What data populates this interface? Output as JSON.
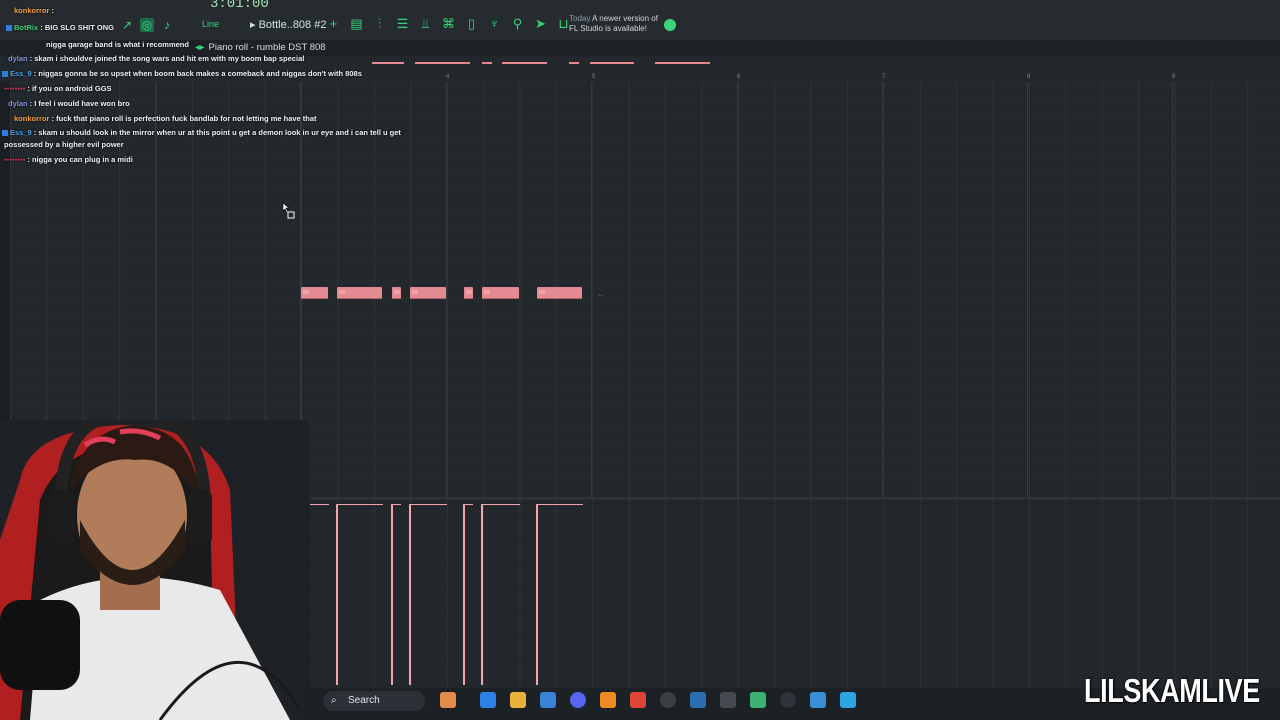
{
  "toolbar": {
    "time": "3:01:00",
    "line_mode": "Line",
    "pattern": "Bottle..808 #2",
    "update_today": "Today",
    "update_msg_1": "A newer version of",
    "update_msg_2": "FL Studio is available!"
  },
  "piano_roll": {
    "title": "Piano roll - rumble DST 808",
    "bar_numbers": [
      "4",
      "5",
      "6",
      "7",
      "8",
      "9"
    ]
  },
  "chat": [
    {
      "user": "konkorror",
      "text": "",
      "user_color": "#f2a33a"
    },
    {
      "user": "BotRix",
      "text": "BIG SLG SHIT ONG",
      "user_color": "#3bd37c"
    },
    {
      "user": "",
      "text": "nigga garage band is what i recommend",
      "user_color": "#c0394a"
    },
    {
      "user": "dylan",
      "text": "skam i shouldve joined the song wars and hit em with my boom bap special",
      "user_color": "#7f92d8"
    },
    {
      "user": "Ess_9",
      "text": "niggas gonna be so upset when boom back makes a comeback and niggas don't with 808s",
      "user_color": "#4ba0e0"
    },
    {
      "user": "",
      "text": "if you on android GGS",
      "user_color": "#c0394a"
    },
    {
      "user": "dylan",
      "text": "I feel i would have won bro",
      "user_color": "#7f92d8"
    },
    {
      "user": "konkorror",
      "text": "fuck that piano roll is perfection fuck bandlab for not letting me have that",
      "user_color": "#f2a33a"
    },
    {
      "user": "Ess_9",
      "text": "skam u should look in the mirror when ur at this point u get a demon look in ur eye and i can tell u get",
      "user_color": "#4ba0e0"
    },
    {
      "user": "",
      "text": "possessed by a higher evil power",
      "user_color": "#f0f0f0"
    },
    {
      "user": "",
      "text": "nigga you can plug in a midi",
      "user_color": "#c0394a"
    }
  ],
  "taskbar": {
    "search_label": "Search"
  },
  "watermark": "LILSKAMLIVE"
}
